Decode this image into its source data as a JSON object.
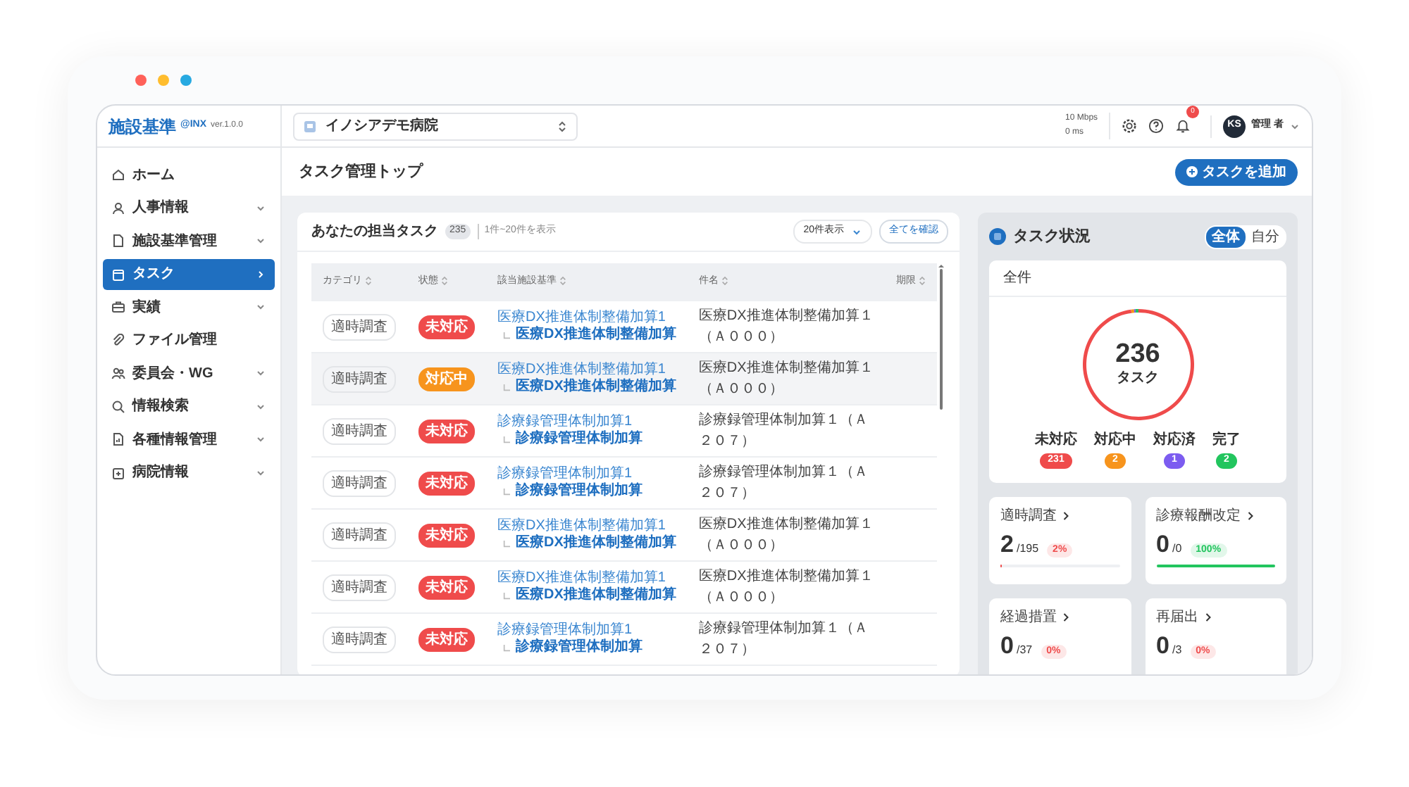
{
  "window": {
    "dots": [
      {
        "color": "#ff6159"
      },
      {
        "color": "#ffbd2e"
      },
      {
        "color": "#27a9e1"
      }
    ]
  },
  "app": {
    "logo": "施設基準",
    "logo_suffix": "@INX",
    "version": "ver.1.0.0"
  },
  "sidebar": {
    "items": [
      {
        "label": "ホーム",
        "expandable": false,
        "selected": false
      },
      {
        "label": "人事情報",
        "expandable": true,
        "selected": false
      },
      {
        "label": "施設基準管理",
        "expandable": true,
        "selected": false
      },
      {
        "label": "タスク",
        "expandable": true,
        "selected": true
      },
      {
        "label": "実績",
        "expandable": true,
        "selected": false
      },
      {
        "label": "ファイル管理",
        "expandable": false,
        "selected": false
      },
      {
        "label": "委員会・WG",
        "expandable": true,
        "selected": false
      },
      {
        "label": "情報検索",
        "expandable": true,
        "selected": false
      },
      {
        "label": "各種情報管理",
        "expandable": true,
        "selected": false
      },
      {
        "label": "病院情報",
        "expandable": true,
        "selected": false
      }
    ]
  },
  "topbar": {
    "facility": "イノシアデモ病院",
    "speed": "10 Mbps",
    "latency": "0 ms",
    "notification_count": "0",
    "user": {
      "initials": "KS",
      "name": "管理 者"
    }
  },
  "page": {
    "title": "タスク管理トップ",
    "add_button": "タスクを追加"
  },
  "tasks": {
    "title": "あなたの担当タスク",
    "count": "235",
    "range": "1件~20件を表示",
    "page_size": "20件表示",
    "view_all": "全てを確認",
    "columns": [
      "カテゴリ",
      "状態",
      "該当施設基準",
      "件名",
      "期限"
    ],
    "rows": [
      {
        "category": "適時調査",
        "status": "未対応",
        "color": "#ef4b4b",
        "standard": "医療DX推進体制整備加算1",
        "standard_sub": "医療DX推進体制整備加算",
        "subject": "医療DX推進体制整備加算１（Ａ０００）",
        "selected": false
      },
      {
        "category": "適時調査",
        "status": "対応中",
        "color": "#f7941d",
        "standard": "医療DX推進体制整備加算1",
        "standard_sub": "医療DX推進体制整備加算",
        "subject": "医療DX推進体制整備加算１（Ａ０００）",
        "selected": true
      },
      {
        "category": "適時調査",
        "status": "未対応",
        "color": "#ef4b4b",
        "standard": "診療録管理体制加算1",
        "standard_sub": "診療録管理体制加算",
        "subject": "診療録管理体制加算１（Ａ２０７）",
        "selected": false
      },
      {
        "category": "適時調査",
        "status": "未対応",
        "color": "#ef4b4b",
        "standard": "診療録管理体制加算1",
        "standard_sub": "診療録管理体制加算",
        "subject": "診療録管理体制加算１（Ａ２０７）",
        "selected": false
      },
      {
        "category": "適時調査",
        "status": "未対応",
        "color": "#ef4b4b",
        "standard": "医療DX推進体制整備加算1",
        "standard_sub": "医療DX推進体制整備加算",
        "subject": "医療DX推進体制整備加算１（Ａ０００）",
        "selected": false
      },
      {
        "category": "適時調査",
        "status": "未対応",
        "color": "#ef4b4b",
        "standard": "医療DX推進体制整備加算1",
        "standard_sub": "医療DX推進体制整備加算",
        "subject": "医療DX推進体制整備加算１（Ａ０００）",
        "selected": false
      },
      {
        "category": "適時調査",
        "status": "未対応",
        "color": "#ef4b4b",
        "standard": "診療録管理体制加算1",
        "standard_sub": "診療録管理体制加算",
        "subject": "診療録管理体制加算１（Ａ２０７）",
        "selected": false
      }
    ]
  },
  "status_panel": {
    "title": "タスク状況",
    "scopes": [
      {
        "label": "全体",
        "selected": true
      },
      {
        "label": "自分",
        "selected": false
      }
    ],
    "summary": {
      "title": "全件",
      "total": "236",
      "unit": "タスク",
      "legend": [
        {
          "label": "未対応",
          "count": "231",
          "color": "#ef4b4b"
        },
        {
          "label": "対応中",
          "count": "2",
          "color": "#f7941d"
        },
        {
          "label": "対応済",
          "count": "1",
          "color": "#7c5cf0"
        },
        {
          "label": "完了",
          "count": "2",
          "color": "#22c55e"
        }
      ]
    },
    "categories": [
      {
        "label": "適時調査",
        "done": "2",
        "total": "/195",
        "percent": "2%",
        "color": "#ef4b4b",
        "level": 0.01
      },
      {
        "label": "診療報酬改定",
        "done": "0",
        "total": "/0",
        "percent": "100%",
        "color": "#22c55e",
        "level": 1
      },
      {
        "label": "経過措置",
        "done": "0",
        "total": "/37",
        "percent": "0%",
        "color": "#ef4b4b"
      },
      {
        "label": "再届出",
        "done": "0",
        "total": "/3",
        "percent": "0%",
        "color": "#ef4b4b"
      }
    ]
  }
}
